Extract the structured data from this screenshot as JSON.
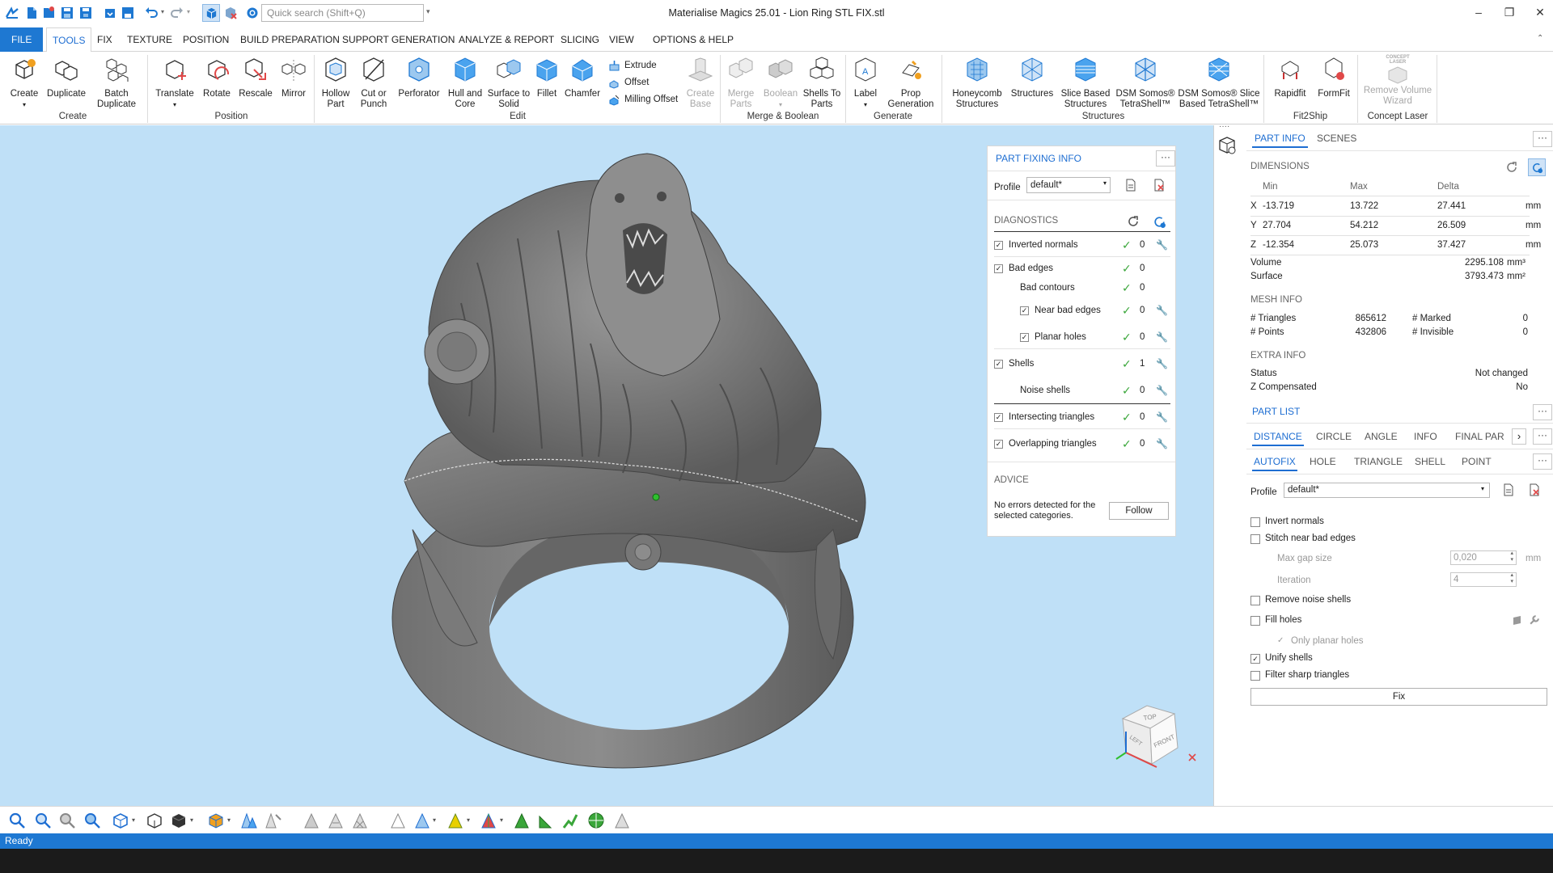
{
  "window": {
    "title": "Materialise Magics 25.01 - Lion Ring STL FIX.stl"
  },
  "search": {
    "placeholder": "Quick search (Shift+Q)"
  },
  "menu": {
    "file": "FILE",
    "tools": "TOOLS",
    "fix": "FIX",
    "texture": "TEXTURE",
    "position": "POSITION",
    "build_preparation": "BUILD PREPARATION",
    "support_generation": "SUPPORT GENERATION",
    "analyze_report": "ANALYZE & REPORT",
    "slicing": "SLICING",
    "view": "VIEW",
    "options_help": "OPTIONS & HELP"
  },
  "ribbon": {
    "create": "Create",
    "duplicate": "Duplicate",
    "batch_duplicate_1": "Batch",
    "batch_duplicate_2": "Duplicate",
    "translate": "Translate",
    "rotate": "Rotate",
    "rescale": "Rescale",
    "mirror": "Mirror",
    "hollow_1": "Hollow",
    "hollow_2": "Part",
    "cut_1": "Cut or",
    "cut_2": "Punch",
    "perforator": "Perforator",
    "hull_1": "Hull and",
    "hull_2": "Core",
    "surface_1": "Surface to",
    "surface_2": "Solid",
    "fillet": "Fillet",
    "chamfer": "Chamfer",
    "extrude": "Extrude",
    "offset": "Offset",
    "milling_offset": "Milling Offset",
    "create_base_1": "Create",
    "create_base_2": "Base",
    "merge_1": "Merge",
    "merge_2": "Parts",
    "boolean": "Boolean",
    "shells_1": "Shells To",
    "shells_2": "Parts",
    "label": "Label",
    "prop_1": "Prop",
    "prop_2": "Generation",
    "honeycomb_1": "Honeycomb",
    "honeycomb_2": "Structures",
    "structures": "Structures",
    "slice_based_1": "Slice Based",
    "slice_based_2": "Structures",
    "dsm1_1": "DSM Somos®",
    "dsm1_2": "TetraShell™",
    "dsm2_1": "DSM Somos® Slice",
    "dsm2_2": "Based TetraShell™",
    "rapidfit": "Rapidfit",
    "formfit": "FormFit",
    "remove_vol_1": "Remove Volume",
    "remove_vol_2": "Wizard",
    "concept_laser_icon_text": "CONCEPT LASER",
    "groups": {
      "create": "Create",
      "position": "Position",
      "edit": "Edit",
      "merge_boolean": "Merge & Boolean",
      "generate": "Generate",
      "structures": "Structures",
      "fit2ship": "Fit2Ship",
      "concept_laser": "Concept Laser"
    }
  },
  "part_fixing": {
    "title": "PART FIXING INFO",
    "more": "···",
    "profile_label": "Profile",
    "profile_value": "default*",
    "diagnostics": "DIAGNOSTICS",
    "rows": [
      {
        "label": "Inverted normals",
        "count": "0"
      },
      {
        "label": "Bad edges",
        "count": "0"
      },
      {
        "label": "Bad contours",
        "count": "0"
      },
      {
        "label": "Near bad edges",
        "count": "0"
      },
      {
        "label": "Planar holes",
        "count": "0"
      },
      {
        "label": "Shells",
        "count": "1"
      },
      {
        "label": "Noise shells",
        "count": "0"
      },
      {
        "label": "Intersecting triangles",
        "count": "0"
      },
      {
        "label": "Overlapping triangles",
        "count": "0"
      }
    ],
    "advice": "ADVICE",
    "advice_text_1": "No errors detected for the",
    "advice_text_2": "selected categories.",
    "follow": "Follow"
  },
  "right_panel": {
    "tabs": {
      "part_info": "PART INFO",
      "scenes": "SCENES"
    },
    "more": "···",
    "dimensions": "DIMENSIONS",
    "dim_headers": {
      "min": "Min",
      "max": "Max",
      "delta": "Delta"
    },
    "dims": [
      {
        "axis": "X",
        "min": "-13.719",
        "max": "13.722",
        "delta": "27.441",
        "unit": "mm"
      },
      {
        "axis": "Y",
        "min": "27.704",
        "max": "54.212",
        "delta": "26.509",
        "unit": "mm"
      },
      {
        "axis": "Z",
        "min": "-12.354",
        "max": "25.073",
        "delta": "37.427",
        "unit": "mm"
      }
    ],
    "volume_label": "Volume",
    "volume_value": "2295.108",
    "volume_unit": "mm³",
    "surface_label": "Surface",
    "surface_value": "3793.473",
    "surface_unit": "mm²",
    "mesh_info": "MESH INFO",
    "triangles_label": "# Triangles",
    "triangles_value": "865612",
    "marked_label": "# Marked",
    "marked_value": "0",
    "points_label": "# Points",
    "points_value": "432806",
    "invisible_label": "# Invisible",
    "invisible_value": "0",
    "extra_info": "EXTRA INFO",
    "status_label": "Status",
    "status_value": "Not changed",
    "zcomp_label": "Z Compensated",
    "zcomp_value": "No",
    "part_list": "PART LIST",
    "tools_tabs": {
      "distance": "DISTANCE",
      "circle": "CIRCLE",
      "angle": "ANGLE",
      "info": "INFO",
      "final_part": "FINAL PAR"
    },
    "fix_tabs": {
      "autofix": "AUTOFIX",
      "hole": "HOLE",
      "triangle": "TRIANGLE",
      "shell": "SHELL",
      "point": "POINT"
    },
    "profile_label": "Profile",
    "profile_value": "default*",
    "options": {
      "invert_normals": "Invert normals",
      "stitch": "Stitch near bad edges",
      "max_gap_label": "Max gap size",
      "max_gap_value": "0,020",
      "max_gap_unit": "mm",
      "iteration_label": "Iteration",
      "iteration_value": "4",
      "remove_noise": "Remove noise shells",
      "fill_holes": "Fill holes",
      "only_planar": "Only planar holes",
      "unify_shells": "Unify shells",
      "filter_sharp": "Filter sharp triangles"
    },
    "fix_button": "Fix"
  },
  "viewcube": {
    "top": "TOP",
    "left": "LEFT",
    "front": "FRONT"
  },
  "status_bar": {
    "text": "Ready"
  },
  "colors": {
    "accent": "#1e78d2",
    "viewport": "#bfe0f7",
    "check_green": "#3aa63a"
  }
}
